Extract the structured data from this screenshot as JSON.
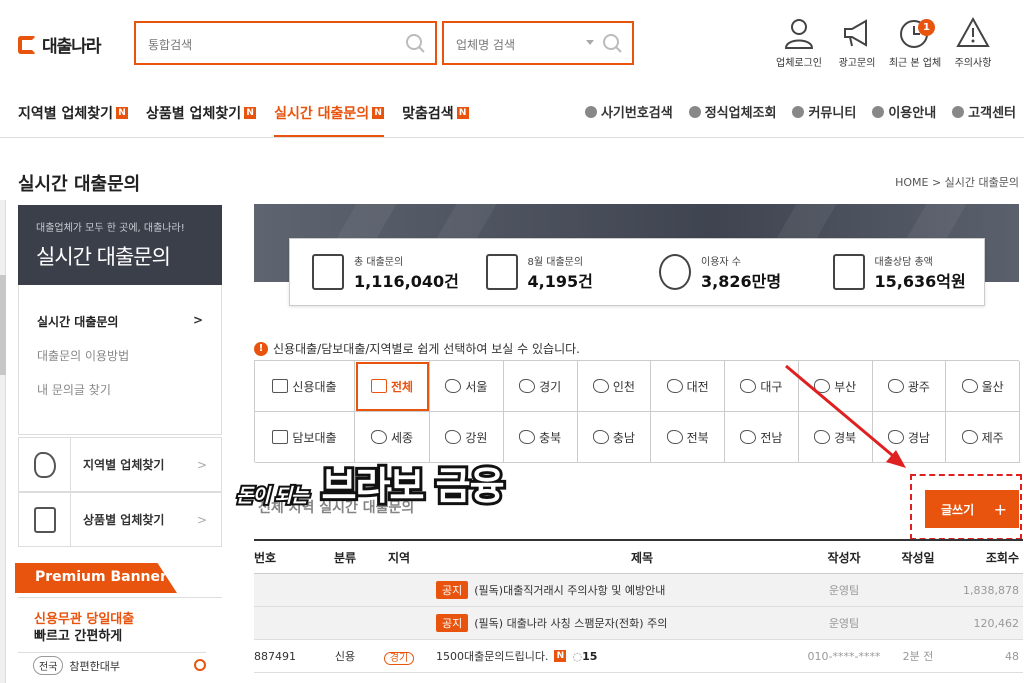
{
  "header": {
    "logo": "대출나라",
    "search_placeholder": "통합검색",
    "company_search_placeholder": "업체명 검색",
    "icons": [
      {
        "name": "user-icon",
        "label": "업체로그인"
      },
      {
        "name": "megaphone-icon",
        "label": "광고문의"
      },
      {
        "name": "clock-icon",
        "label": "최근 본 업체",
        "badge": "1"
      },
      {
        "name": "warning-icon",
        "label": "주의사항"
      }
    ]
  },
  "nav": {
    "items": [
      {
        "label": "지역별 업체찾기",
        "badge": "N"
      },
      {
        "label": "상품별 업체찾기",
        "badge": "N"
      },
      {
        "label": "실시간 대출문의",
        "badge": "N",
        "active": true
      },
      {
        "label": "맞춤검색",
        "badge": "N"
      }
    ],
    "right": [
      "사기번호검색",
      "정식업체조회",
      "커뮤니티",
      "이용안내",
      "고객센터"
    ]
  },
  "page": {
    "title": "실시간 대출문의",
    "breadcrumb": "HOME > 실시간 대출문의"
  },
  "sidebar": {
    "banner_sub": "대출업체가 모두 한 곳에, 대출나라!",
    "banner_main": "실시간 대출문의",
    "menu": [
      {
        "label": "실시간 대출문의",
        "active": true
      },
      {
        "label": "대출문의 이용방법"
      },
      {
        "label": "내 문의글 찾기"
      }
    ],
    "links": [
      "지역별 업체찾기",
      "상품별 업체찾기"
    ],
    "premium_title": "Premium Banner",
    "premium_line1": "신용무관 당일대출",
    "premium_line2": "빠르고 간편하게",
    "premium_tag": "전국",
    "premium_name": "참편한대부"
  },
  "stats": [
    {
      "label": "총 대출문의",
      "value": "1,116,040건"
    },
    {
      "label": "8월 대출문의",
      "value": "4,195건"
    },
    {
      "label": "이용자 수",
      "value": "3,826만명"
    },
    {
      "label": "대출상담 총액",
      "value": "15,636억원"
    }
  ],
  "filter": {
    "notice": "신용대출/담보대출/지역별로 쉽게 선택하여 보실 수 있습니다.",
    "row1": [
      "신용대출",
      "전체",
      "서울",
      "경기",
      "인천",
      "대전",
      "대구",
      "부산",
      "광주",
      "울산"
    ],
    "row2": [
      "담보대출",
      "세종",
      "강원",
      "충북",
      "충남",
      "전북",
      "전남",
      "경북",
      "경남",
      "제주"
    ]
  },
  "overlay": {
    "small": "돈이 되는",
    "big": "브라보 금융"
  },
  "write_button": "글쓰기",
  "write_plus": "+",
  "section_title": "전체 지역 실시간 대출문의",
  "table": {
    "headers": [
      "번호",
      "분류",
      "지역",
      "제목",
      "작성자",
      "작성일",
      "조회수"
    ],
    "rows": [
      {
        "num": "",
        "cat": "",
        "region": "",
        "tag": "공지",
        "title": "(필독)대출직거래시 주의사항 및 예방안내",
        "author": "운영팀",
        "date": "",
        "views": "1,838,878"
      },
      {
        "num": "",
        "cat": "",
        "region": "",
        "tag": "공지",
        "title": "(필독) 대출나라 사칭 스팸문자(전화) 주의",
        "author": "운영팀",
        "date": "",
        "views": "120,462"
      },
      {
        "num": "887491",
        "cat": "신용",
        "region": "",
        "region_tag": "경기",
        "title": "1500대출문의드립니다.",
        "new": "N",
        "comments": "15",
        "author": "010-****-****",
        "date": "2분 전",
        "views": "48"
      }
    ]
  }
}
